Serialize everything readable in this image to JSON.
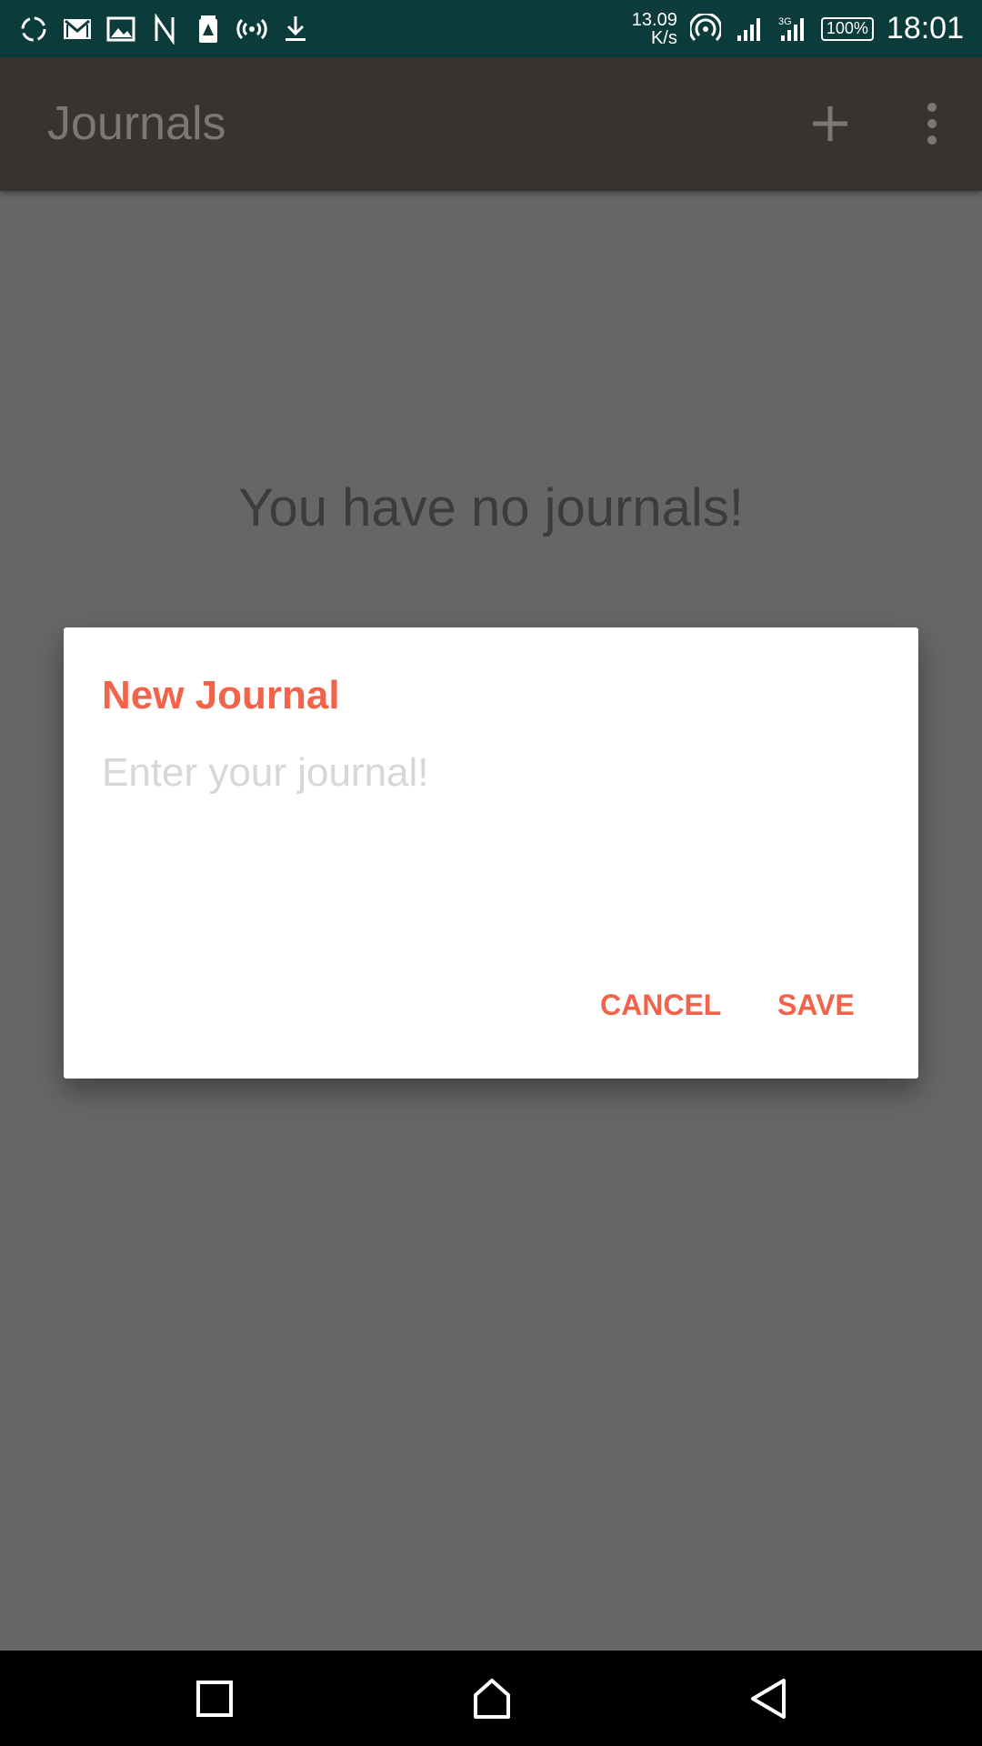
{
  "status_bar": {
    "net_speed_value": "13.09",
    "net_speed_unit": "K/s",
    "battery": "100%",
    "time": "18:01",
    "left_icons": [
      "sync-icon",
      "gmail-icon",
      "gallery-icon",
      "n-icon",
      "battery-alert-icon",
      "hotspot-icon",
      "download-icon"
    ],
    "right_icons": [
      "wifi-icon",
      "signal-icon",
      "signal-3g-icon"
    ]
  },
  "app_bar": {
    "title": "Journals",
    "actions": [
      "add-icon",
      "more-vert-icon"
    ]
  },
  "main": {
    "empty_message": "You have no journals!"
  },
  "dialog": {
    "title": "New Journal",
    "input_value": "",
    "input_placeholder": "Enter your journal!",
    "cancel_label": "CANCEL",
    "save_label": "SAVE"
  },
  "nav_bar": {
    "buttons": [
      "recent-apps-icon",
      "home-icon",
      "back-icon"
    ]
  },
  "colors": {
    "status_bar_bg": "#0c3b3b",
    "app_bar_bg": "#37342f",
    "scrim_bg": "#666666",
    "accent": "#f2634a"
  }
}
